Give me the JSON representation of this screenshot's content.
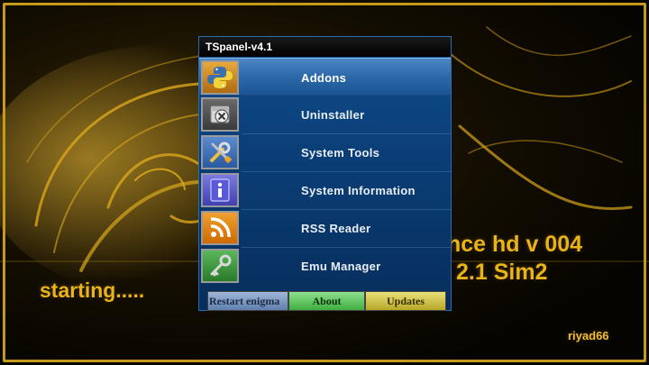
{
  "background": {
    "status_text": "starting.....",
    "skin_name_line1": "nce hd v 004",
    "skin_name_line2": "2.1 Sim2",
    "author": "riyad66",
    "accent_color": "#e8b418"
  },
  "panel": {
    "title": "TSpanel-v4.1",
    "selected_index": 0,
    "items": [
      {
        "label": "Addons",
        "icon": "python-icon",
        "selected": true
      },
      {
        "label": "Uninstaller",
        "icon": "package-remove-icon",
        "selected": false
      },
      {
        "label": "System Tools",
        "icon": "tools-icon",
        "selected": false
      },
      {
        "label": "System Information",
        "icon": "info-icon",
        "selected": false
      },
      {
        "label": "RSS Reader",
        "icon": "rss-icon",
        "selected": false
      },
      {
        "label": "Emu Manager",
        "icon": "key-icon",
        "selected": false
      }
    ],
    "buttons": {
      "red": "Restart enigma",
      "green": "About",
      "yellow": "Updates"
    }
  }
}
